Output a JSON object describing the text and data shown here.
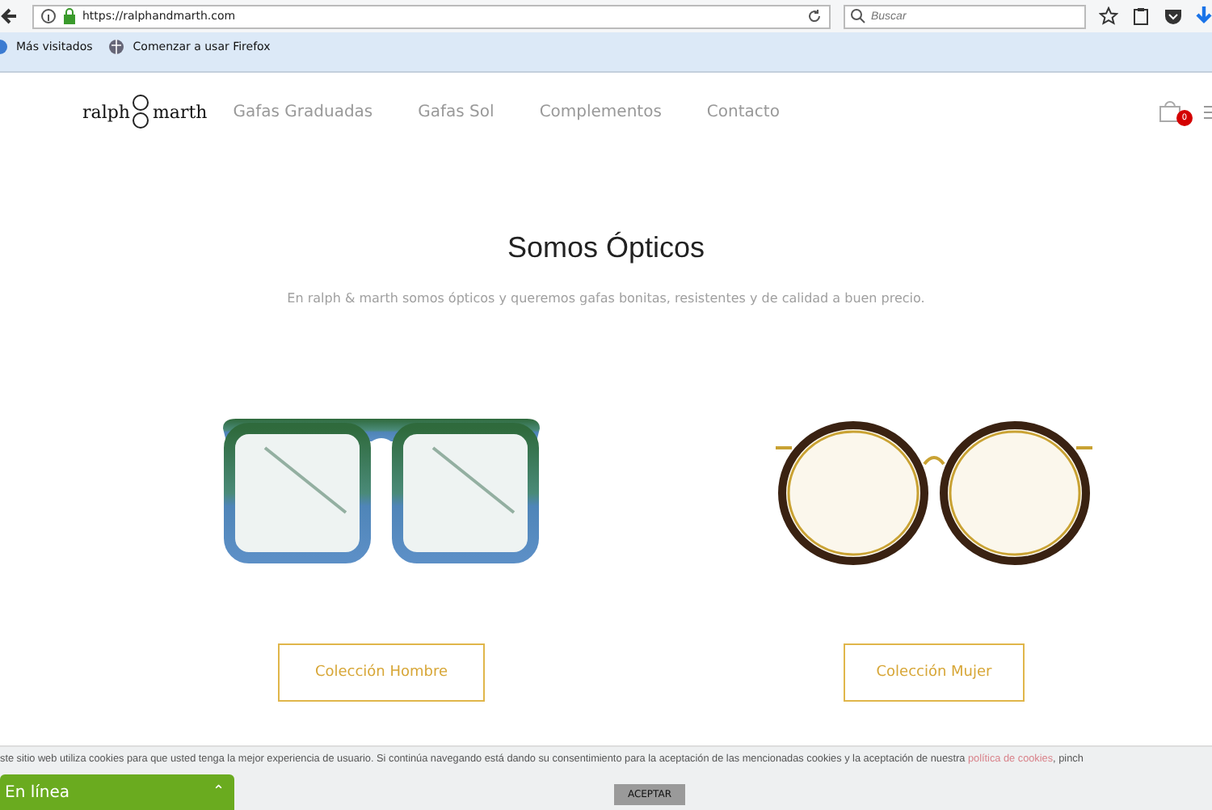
{
  "browser": {
    "url": "https://ralphandmarth.com",
    "search": {
      "placeholder": "Buscar"
    },
    "bookmarks": [
      "Más visitados",
      "Comenzar a usar Firefox"
    ]
  },
  "site": {
    "logo": {
      "left": "ralph",
      "right": "marth"
    },
    "nav": [
      "Gafas Graduadas",
      "Gafas Sol",
      "Complementos",
      "Contacto"
    ],
    "cart_count": "0"
  },
  "hero": {
    "title": "Somos Ópticos",
    "subtitle": "En ralph & marth somos ópticos y queremos gafas bonitas, resistentes y de calidad a buen precio."
  },
  "collections": [
    {
      "kind": "square",
      "button": "Colección Hombre"
    },
    {
      "kind": "round",
      "button": "Colección Mujer"
    }
  ],
  "cookie_bar": {
    "text": "ste sitio web utiliza cookies para que usted tenga la mejor experiencia de usuario. Si continúa navegando está dando su consentimiento para la aceptación de las mencionadas cookies y la aceptación de nuestra ",
    "link": "política de cookies",
    "after": ", pinch",
    "button": "ACEPTAR"
  },
  "chat": {
    "label": "En línea",
    "toggle": "⌃"
  }
}
